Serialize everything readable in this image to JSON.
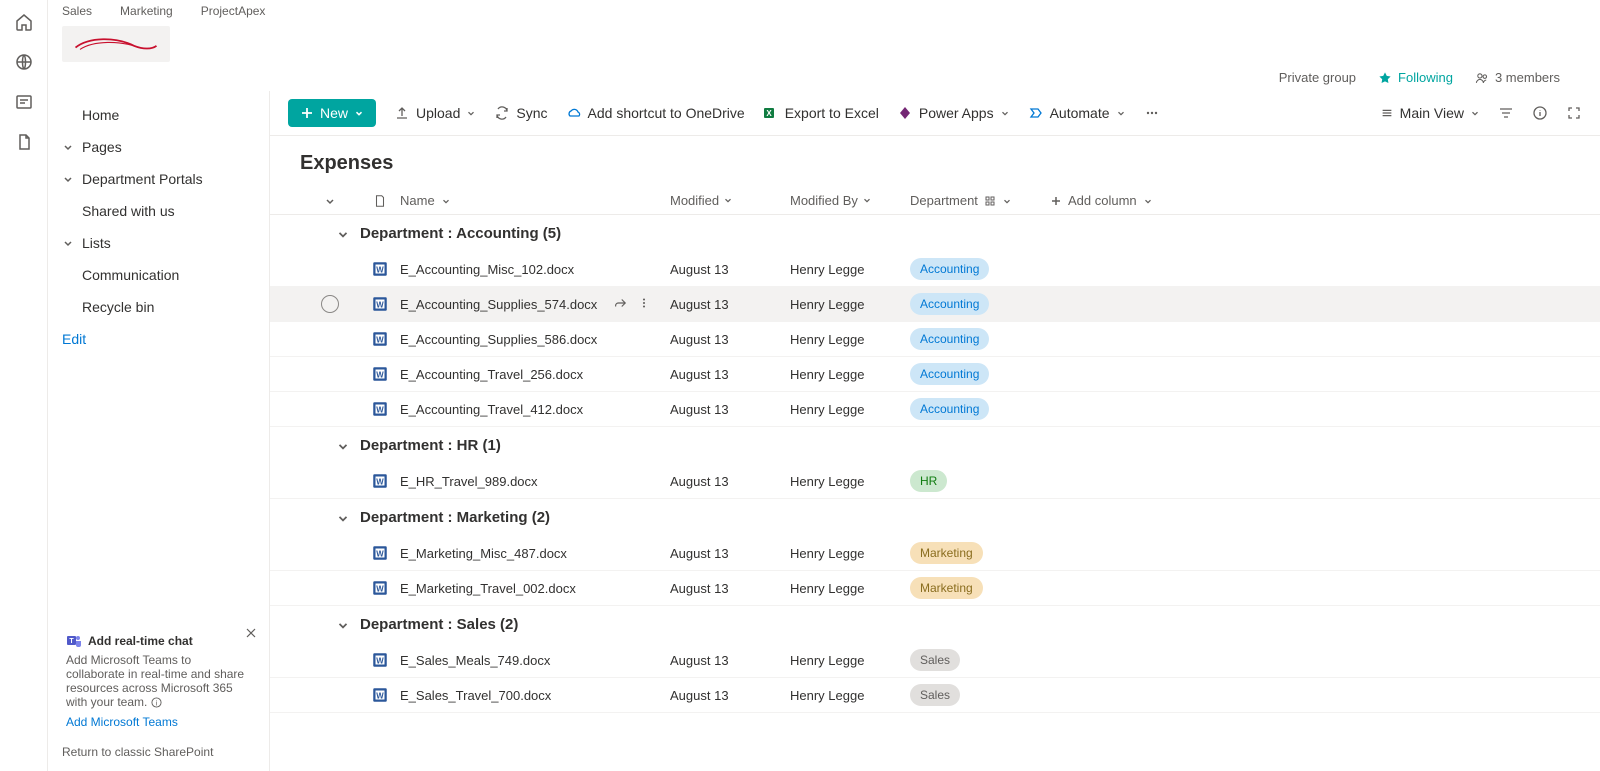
{
  "topTabs": [
    "Sales",
    "Marketing",
    "ProjectApex"
  ],
  "siteMeta": {
    "privacy": "Private group",
    "following": "Following",
    "members": "3 members"
  },
  "nav": {
    "home": "Home",
    "pages": "Pages",
    "deptPortals": "Department Portals",
    "shared": "Shared with us",
    "lists": "Lists",
    "communication": "Communication",
    "recycle": "Recycle bin",
    "edit": "Edit"
  },
  "teamsPromo": {
    "title": "Add real-time chat",
    "body": "Add Microsoft Teams to collaborate in real-time and share resources across Microsoft 365 with your team.",
    "link": "Add Microsoft Teams"
  },
  "returnLink": "Return to classic SharePoint",
  "cmd": {
    "new": "New",
    "upload": "Upload",
    "sync": "Sync",
    "shortcut": "Add shortcut to OneDrive",
    "export": "Export to Excel",
    "powerapps": "Power Apps",
    "automate": "Automate",
    "view": "Main View"
  },
  "listTitle": "Expenses",
  "columns": {
    "name": "Name",
    "modified": "Modified",
    "modifiedBy": "Modified By",
    "department": "Department",
    "add": "Add column"
  },
  "groups": [
    {
      "label": "Department : Accounting (5)",
      "dept": "Accounting",
      "items": [
        {
          "name": "E_Accounting_Misc_102.docx",
          "modified": "August 13",
          "by": "Henry Legge",
          "hover": false
        },
        {
          "name": "E_Accounting_Supplies_574.docx",
          "modified": "August 13",
          "by": "Henry Legge",
          "hover": true
        },
        {
          "name": "E_Accounting_Supplies_586.docx",
          "modified": "August 13",
          "by": "Henry Legge",
          "hover": false
        },
        {
          "name": "E_Accounting_Travel_256.docx",
          "modified": "August 13",
          "by": "Henry Legge",
          "hover": false
        },
        {
          "name": "E_Accounting_Travel_412.docx",
          "modified": "August 13",
          "by": "Henry Legge",
          "hover": false
        }
      ]
    },
    {
      "label": "Department : HR (1)",
      "dept": "HR",
      "items": [
        {
          "name": "E_HR_Travel_989.docx",
          "modified": "August 13",
          "by": "Henry Legge",
          "hover": false
        }
      ]
    },
    {
      "label": "Department : Marketing (2)",
      "dept": "Marketing",
      "items": [
        {
          "name": "E_Marketing_Misc_487.docx",
          "modified": "August 13",
          "by": "Henry Legge",
          "hover": false
        },
        {
          "name": "E_Marketing_Travel_002.docx",
          "modified": "August 13",
          "by": "Henry Legge",
          "hover": false
        }
      ]
    },
    {
      "label": "Department : Sales (2)",
      "dept": "Sales",
      "items": [
        {
          "name": "E_Sales_Meals_749.docx",
          "modified": "August 13",
          "by": "Henry Legge",
          "hover": false
        },
        {
          "name": "E_Sales_Travel_700.docx",
          "modified": "August 13",
          "by": "Henry Legge",
          "hover": false
        }
      ]
    }
  ]
}
